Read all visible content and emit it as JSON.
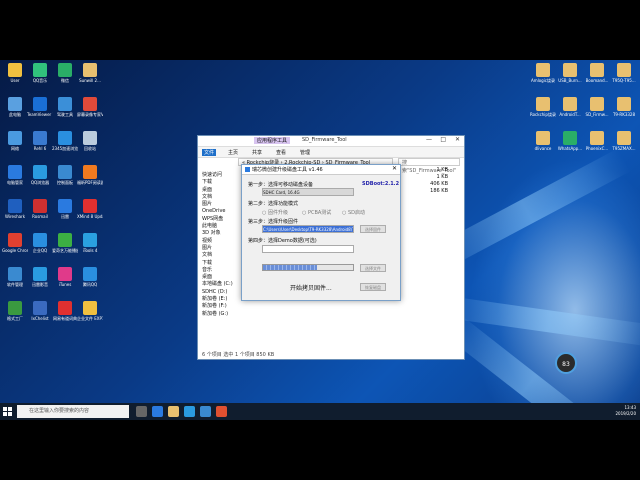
{
  "desktop_icons_left": [
    {
      "label": "User",
      "color": "#f0c040"
    },
    {
      "label": "QQ音乐",
      "color": "#31c27c"
    },
    {
      "label": "微信",
      "color": "#2aae67"
    },
    {
      "label": "Sunwill 2...",
      "color": "#e8c070"
    },
    {
      "label": "此电脑",
      "color": "#5aa0e0"
    },
    {
      "label": "TeamViewer 13",
      "color": "#1a6fd6"
    },
    {
      "label": "驾驶工具",
      "color": "#3b8fd8"
    },
    {
      "label": "屏幕录像专家V2017",
      "color": "#e04a3a"
    },
    {
      "label": "网络",
      "color": "#4a9ae0"
    },
    {
      "label": "Rehl 6",
      "color": "#3a7ad0"
    },
    {
      "label": "2345加速浏览器",
      "color": "#2a8fe0"
    },
    {
      "label": "回收站",
      "color": "#bcd"
    },
    {
      "label": "电脑管家",
      "color": "#2a7ae0"
    },
    {
      "label": "QQ浏览器",
      "color": "#2a9be0"
    },
    {
      "label": "控制面板",
      "color": "#3a8ad0"
    },
    {
      "label": "福昕PDF阅读器",
      "color": "#f07a20"
    },
    {
      "label": "Wireshark",
      "color": "#1f5fbf"
    },
    {
      "label": "Rosmail",
      "color": "#d03030"
    },
    {
      "label": "迅雷",
      "color": "#2a7ae0"
    },
    {
      "label": "XMind 8 Update 6",
      "color": "#e03030"
    },
    {
      "label": "Google Chrome",
      "color": "#e04030"
    },
    {
      "label": "企业QQ",
      "color": "#2a8fe0"
    },
    {
      "label": "爱奇艺万能播放器",
      "color": "#3cb043"
    },
    {
      "label": "iTools 4",
      "color": "#2aa0e0"
    },
    {
      "label": "软件管理",
      "color": "#3a8ad0"
    },
    {
      "label": "迅雷影音",
      "color": "#2a9be0"
    },
    {
      "label": "iTunes",
      "color": "#e03a8a"
    },
    {
      "label": "腾讯QQ",
      "color": "#2a8fe0"
    },
    {
      "label": "格式工厂",
      "color": "#3a9a40"
    },
    {
      "label": "IxChelist",
      "color": "#3a6ac0"
    },
    {
      "label": "网易有道词典",
      "color": "#e03030"
    },
    {
      "label": "企业文件 EXP12.3.6...",
      "color": "#f0c040"
    }
  ],
  "desktop_icons_right": [
    {
      "label": "Amlogic烧录",
      "color": "#e8c070"
    },
    {
      "label": "USB_Burn...",
      "color": "#e8c070"
    },
    {
      "label": "Boomand...",
      "color": "#e8c070"
    },
    {
      "label": "T95Q-T95...",
      "color": "#e8c070"
    },
    {
      "label": "Rockchip烧录工具",
      "color": "#e8c070"
    },
    {
      "label": "AndroidT...",
      "color": "#e8c070"
    },
    {
      "label": "SD_Firmw...",
      "color": "#e8c070"
    },
    {
      "label": "T9-RK3328",
      "color": "#e8c070"
    },
    {
      "label": "dlivance",
      "color": "#e8c070"
    },
    {
      "label": "WhatsApp...",
      "color": "#2aae67"
    },
    {
      "label": "PhoenixC...",
      "color": "#e8c070"
    },
    {
      "label": "T95ZMAX...",
      "color": "#e8c070"
    }
  ],
  "notification_badge": "83",
  "explorer": {
    "title": "SD_Firmware_Tool",
    "ribbon_group": "应用程序工具",
    "tabs": [
      "文件",
      "主页",
      "共享",
      "查看",
      "管理"
    ],
    "address": "« Rockchip烧录 › 2.Rockchip-SD › SD_Firmware_Tool",
    "search_placeholder": "搜索\"SD_Firmware_Tool\"",
    "nav_items": [
      "快速访问",
      "下载",
      "桌面",
      "文档",
      "图片",
      "OneDrive",
      "WPS网盘",
      "此电脑",
      "3D 对象",
      "视频",
      "图片",
      "文档",
      "下载",
      "音乐",
      "桌面",
      "本地磁盘 (C:)",
      "SDHC (D:)",
      "新加卷 (E:)",
      "新加卷 (F:)",
      "新加卷 (G:)"
    ],
    "sizes": [
      "1 KB",
      "1 KB",
      "406 KB",
      "186 KB"
    ],
    "status": "6 个项目   选中 1 个项目  850 KB"
  },
  "dialog": {
    "title": "瑞芯微创建升级磁盘工具 v1.46",
    "step1": "第一步：选择可移动磁盘设备",
    "version": "SDBoot:2.1.2",
    "device": "SDHC Card, 16.4G",
    "step2": "第二步：选择功能模式",
    "mode_options": [
      "固件升级",
      "PCBA测试",
      "SD启动"
    ],
    "step3": "第三步：选择升级固件",
    "firmware_path": "C:\\Users\\User\\Desktop\\T9-RK3328\\Android8\\T9-RK3328_Android.img",
    "firmware_button": "选择固件",
    "step4": "第四步：选择Demo数据(可选)",
    "demo_button": "选择文件",
    "restore_button": "恢复磁盘",
    "progress": 0.6,
    "status_text": "开始拷贝固件..."
  },
  "taskbar": {
    "search_placeholder": "在这里输入你要搜索的内容",
    "time": "13:43",
    "date": "2019/2/20"
  }
}
